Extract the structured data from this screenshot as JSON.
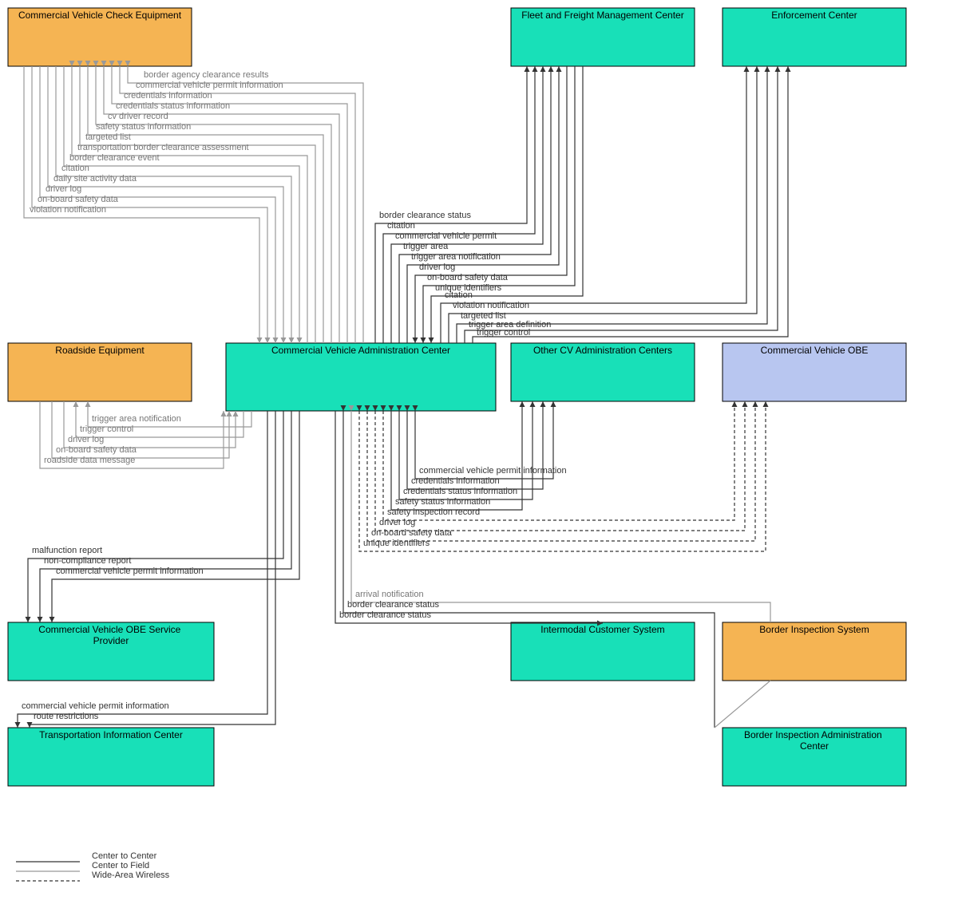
{
  "nodes": {
    "cvce": {
      "label": "Commercial Vehicle Check Equipment",
      "fill": "#f5b453"
    },
    "ffmc": {
      "label": "Fleet and Freight Management Center",
      "fill": "#18e0b8"
    },
    "ec": {
      "label": "Enforcement Center",
      "fill": "#18e0b8"
    },
    "re": {
      "label": "Roadside Equipment",
      "fill": "#f5b453"
    },
    "cvac": {
      "label": "Commercial Vehicle Administration Center",
      "fill": "#18e0b8"
    },
    "ocvac": {
      "label": "Other CV Administration Centers",
      "fill": "#18e0b8"
    },
    "cvobe": {
      "label": "Commercial Vehicle OBE",
      "fill": "#b8c6f0"
    },
    "cvosp": {
      "label": "Commercial Vehicle OBE Service Provider",
      "fill": "#18e0b8"
    },
    "ics": {
      "label": "Intermodal Customer System",
      "fill": "#18e0b8"
    },
    "bis": {
      "label": "Border Inspection System",
      "fill": "#f5b453"
    },
    "tic": {
      "label": "Transportation Information Center",
      "fill": "#18e0b8"
    },
    "biac": {
      "label": "Border Inspection Administration Center",
      "fill": "#18e0b8"
    }
  },
  "flows_cvce_from_cvac": [
    "border agency clearance results",
    "commercial vehicle permit information",
    "credentials information",
    "credentials status information",
    "cv driver record",
    "safety status information",
    "targeted list",
    "transportation border clearance assessment"
  ],
  "flows_cvce_to_cvac": [
    "border clearance event",
    "citation",
    "daily site activity data",
    "driver log",
    "on-board safety data",
    "violation notification"
  ],
  "flows_ffmc_from_cvac": [
    "border clearance status",
    "citation",
    "commercial vehicle permit",
    "trigger area",
    "trigger area notification"
  ],
  "flows_ffmc_to_cvac": [
    "driver log",
    "on-board safety data",
    "unique identifiers"
  ],
  "flows_ec_from_cvac": [
    "citation",
    "violation notification",
    "targeted list",
    "trigger area definition",
    "trigger control"
  ],
  "flows_re_from_cvac": [
    "trigger area notification",
    "trigger control"
  ],
  "flows_re_to_cvac": [
    "driver log",
    "on-board safety data",
    "roadside data message"
  ],
  "flows_ocvac_bidir": [
    "commercial vehicle permit information",
    "credentials information",
    "credentials status information",
    "safety status information"
  ],
  "flows_cvobe_bidir": [
    "safety inspection record",
    "driver log",
    "on-board safety data",
    "unique identifiers"
  ],
  "flows_cvosp_from_cvac": [
    "malfunction report",
    "non-compliance report",
    "commercial vehicle permit information"
  ],
  "flows_tic_from_cvac": [
    "commercial vehicle permit information",
    "route restrictions"
  ],
  "flows_bis_biac": [
    "arrival notification"
  ],
  "flows_bis_cvac": [
    "border clearance status"
  ],
  "flows_ics_cvac": [
    "border clearance status"
  ],
  "legend": {
    "c2c": "Center to Center",
    "c2f": "Center to Field",
    "waw": "Wide-Area Wireless"
  },
  "chart_data": {
    "type": "diagram",
    "title": "Commercial Vehicle Administration Center interconnect diagram",
    "center_node": "Commercial Vehicle Administration Center",
    "edges": [
      {
        "from": "Commercial Vehicle Administration Center",
        "to": "Commercial Vehicle Check Equipment",
        "link": "Center to Field",
        "flows": [
          "border agency clearance results",
          "commercial vehicle permit information",
          "credentials information",
          "credentials status information",
          "cv driver record",
          "safety status information",
          "targeted list",
          "transportation border clearance assessment"
        ]
      },
      {
        "from": "Commercial Vehicle Check Equipment",
        "to": "Commercial Vehicle Administration Center",
        "link": "Center to Field",
        "flows": [
          "border clearance event",
          "citation",
          "daily site activity data",
          "driver log",
          "on-board safety data",
          "violation notification"
        ]
      },
      {
        "from": "Commercial Vehicle Administration Center",
        "to": "Fleet and Freight Management Center",
        "link": "Center to Center",
        "flows": [
          "border clearance status",
          "citation",
          "commercial vehicle permit",
          "trigger area",
          "trigger area notification"
        ]
      },
      {
        "from": "Fleet and Freight Management Center",
        "to": "Commercial Vehicle Administration Center",
        "link": "Center to Center",
        "flows": [
          "driver log",
          "on-board safety data",
          "unique identifiers"
        ]
      },
      {
        "from": "Commercial Vehicle Administration Center",
        "to": "Enforcement Center",
        "link": "Center to Center",
        "flows": [
          "citation",
          "violation notification",
          "targeted list",
          "trigger area definition",
          "trigger control"
        ]
      },
      {
        "from": "Commercial Vehicle Administration Center",
        "to": "Roadside Equipment",
        "link": "Center to Field",
        "flows": [
          "trigger area notification",
          "trigger control"
        ]
      },
      {
        "from": "Roadside Equipment",
        "to": "Commercial Vehicle Administration Center",
        "link": "Center to Field",
        "flows": [
          "driver log",
          "on-board safety data",
          "roadside data message"
        ]
      },
      {
        "from": "Commercial Vehicle Administration Center",
        "to": "Other CV Administration Centers",
        "link": "Center to Center",
        "bidirectional": true,
        "flows": [
          "commercial vehicle permit information",
          "credentials information",
          "credentials status information",
          "safety status information"
        ]
      },
      {
        "from": "Commercial Vehicle Administration Center",
        "to": "Commercial Vehicle OBE",
        "link": "Wide-Area Wireless",
        "bidirectional": true,
        "flows": [
          "safety inspection record",
          "driver log",
          "on-board safety data",
          "unique identifiers"
        ]
      },
      {
        "from": "Commercial Vehicle Administration Center",
        "to": "Commercial Vehicle OBE Service Provider",
        "link": "Center to Center",
        "flows": [
          "malfunction report",
          "non-compliance report",
          "commercial vehicle permit information"
        ]
      },
      {
        "from": "Commercial Vehicle Administration Center",
        "to": "Transportation Information Center",
        "link": "Center to Center",
        "flows": [
          "commercial vehicle permit information",
          "route restrictions"
        ]
      },
      {
        "from": "Border Inspection System",
        "to": "Border Inspection Administration Center",
        "link": "Center to Field",
        "flows": [
          "arrival notification"
        ]
      },
      {
        "from": "Border Inspection Administration Center",
        "to": "Commercial Vehicle Administration Center",
        "link": "Center to Center",
        "flows": [
          "border clearance status"
        ]
      },
      {
        "from": "Commercial Vehicle Administration Center",
        "to": "Intermodal Customer System",
        "link": "Center to Center",
        "flows": [
          "border clearance status"
        ]
      }
    ]
  }
}
